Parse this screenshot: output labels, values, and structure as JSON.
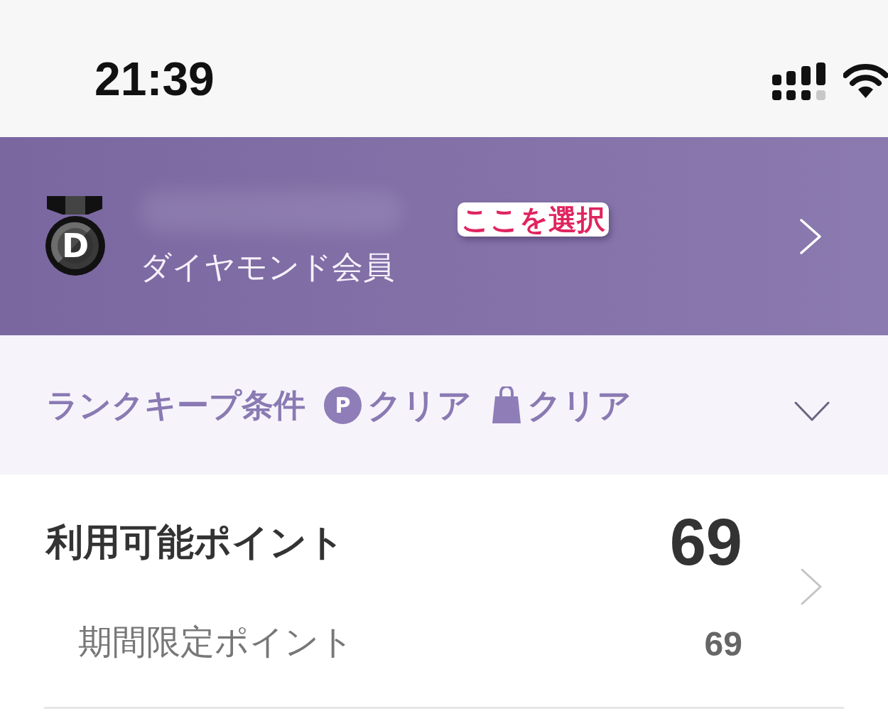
{
  "status_bar": {
    "time": "21:39"
  },
  "member_header": {
    "badge_letter": "D",
    "rank": "ダイヤモンド会員",
    "annotation": "ここを選択"
  },
  "rank_keep": {
    "label": "ランクキープ条件",
    "expanded": false,
    "conditions": [
      {
        "kind": "points",
        "icon_letter": "P",
        "status": "クリア"
      },
      {
        "kind": "shopping",
        "status": "クリア"
      }
    ]
  },
  "points": {
    "label": "利用可能ポイント",
    "value": "69",
    "sub_items": [
      {
        "label": "期間限定ポイント",
        "value": "69"
      }
    ]
  }
}
